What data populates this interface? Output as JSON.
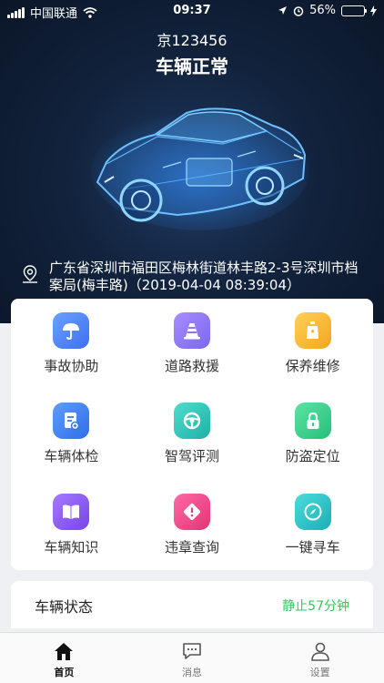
{
  "status_bar": {
    "carrier": "中国联通",
    "time": "09:37",
    "battery": "56%",
    "battery_level": 0.56
  },
  "header": {
    "plate": "京123456",
    "vehicle_status": "车辆正常"
  },
  "location": {
    "address": "广东省深圳市福田区梅林街道林丰路2-3号深圳市档案局(梅丰路)（2019-04-04 08:39:04）"
  },
  "services": [
    {
      "label": "事故协助",
      "icon": "umbrella-icon",
      "color": "#4a7cf6"
    },
    {
      "label": "道路救援",
      "icon": "traffic-cone-icon",
      "color": "#8f7cf6"
    },
    {
      "label": "保养维修",
      "icon": "oil-bottle-icon",
      "color": "#f7b531"
    },
    {
      "label": "车辆体检",
      "icon": "report-icon",
      "color": "#3f82f0"
    },
    {
      "label": "智驾评测",
      "icon": "steering-wheel-icon",
      "color": "#2cc1b4"
    },
    {
      "label": "防盗定位",
      "icon": "lock-icon",
      "color": "#3ecf8e"
    },
    {
      "label": "车辆知识",
      "icon": "book-icon",
      "color": "#8e5cf0"
    },
    {
      "label": "违章查询",
      "icon": "warning-icon",
      "color": "#ef4a8a"
    },
    {
      "label": "一键寻车",
      "icon": "compass-icon",
      "color": "#2cc0c6"
    }
  ],
  "vehicle_state": {
    "title": "车辆状态",
    "value": "静止57分钟"
  },
  "tabs": [
    {
      "label": "首页",
      "icon": "home-icon",
      "active": true
    },
    {
      "label": "消息",
      "icon": "message-icon",
      "active": false
    },
    {
      "label": "设置",
      "icon": "user-icon",
      "active": false
    }
  ]
}
